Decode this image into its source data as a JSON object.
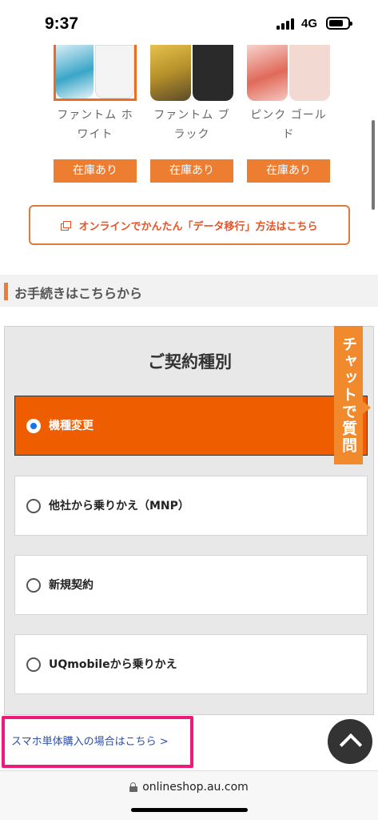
{
  "status_bar": {
    "time": "9:37",
    "network": "4G"
  },
  "colors": {
    "accent": "#ed7d31",
    "selected_option": "#ee5e00",
    "highlight": "#ec1a7a",
    "link": "#2b4fa8"
  },
  "products": [
    {
      "name_line1": "ファントム ホ",
      "name_line2": "ワイト",
      "stock": "在庫あり"
    },
    {
      "name_line1": "ファントム ブ",
      "name_line2": "ラック",
      "stock": "在庫あり"
    },
    {
      "name_line1": "ピンク ゴール",
      "name_line2": "ド",
      "stock": "在庫あり"
    }
  ],
  "data_transfer": {
    "label": "オンラインでかんたん「データ移行」方法はこちら"
  },
  "section": {
    "title": "お手続きはこちらから"
  },
  "contract": {
    "title": "ご契約種別",
    "options": [
      {
        "label": "機種変更",
        "selected": true
      },
      {
        "label": "他社から乗りかえ（MNP）",
        "selected": false
      },
      {
        "label": "新規契約",
        "selected": false
      },
      {
        "label": "UQmobileから乗りかえ",
        "selected": false
      }
    ]
  },
  "chat": {
    "label": "チャットで質問"
  },
  "sim_free_link": {
    "label": "スマホ単体購入の場合はこちら >"
  },
  "url_bar": {
    "domain": "onlineshop.au.com"
  }
}
